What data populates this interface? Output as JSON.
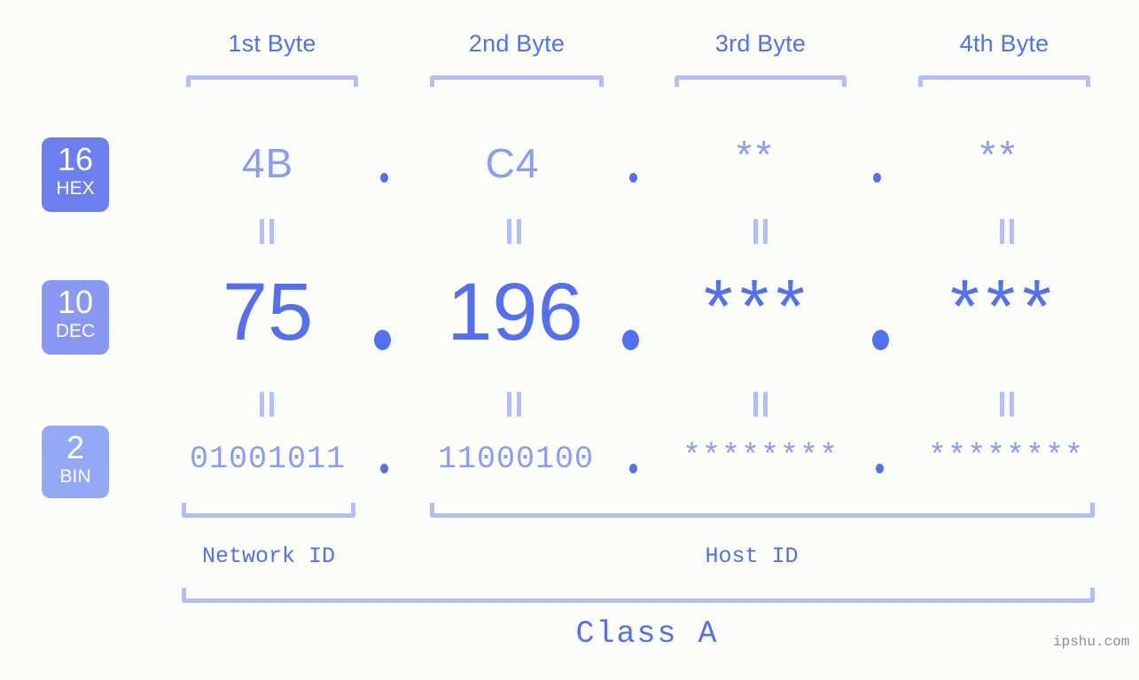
{
  "background_color": "#fbfdf9",
  "accent_color": "#5570ee",
  "accent_light_color": "#8c9cf0",
  "bracket_color": "#b3bdf9",
  "byte_headers": [
    {
      "label": "1st Byte"
    },
    {
      "label": "2nd Byte"
    },
    {
      "label": "3rd Byte"
    },
    {
      "label": "4th Byte"
    }
  ],
  "rows": [
    {
      "id": "hex",
      "badge_number": "16",
      "badge_label": "HEX",
      "badge_color": "#6b80ee",
      "values": [
        "4B",
        "C4",
        "**",
        "**"
      ]
    },
    {
      "id": "dec",
      "badge_number": "10",
      "badge_label": "DEC",
      "badge_color": "#8998f2",
      "values": [
        "75",
        "196",
        "***",
        "***"
      ]
    },
    {
      "id": "bin",
      "badge_number": "2",
      "badge_label": "BIN",
      "badge_color": "#93a9f5",
      "values": [
        "01001011",
        "11000100",
        "********",
        "********"
      ]
    }
  ],
  "separator": ".",
  "equals_mark": "||",
  "id_labels": {
    "network": "Network ID",
    "host": "Host ID"
  },
  "class_label": "Class A",
  "watermark": "ipshu.com"
}
